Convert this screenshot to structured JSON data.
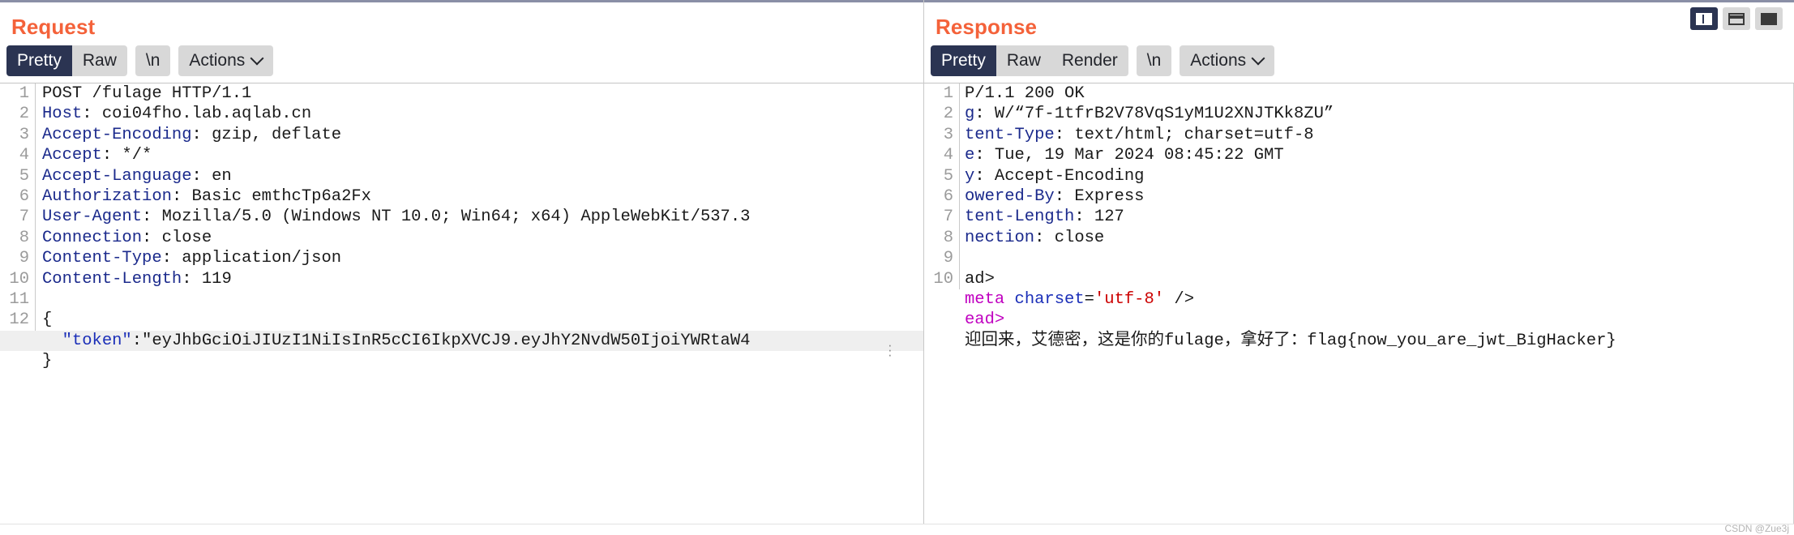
{
  "window": {
    "layout_buttons": [
      {
        "name": "split-vertical",
        "active": true
      },
      {
        "name": "split-horizontal",
        "active": false
      },
      {
        "name": "single-pane",
        "active": false
      }
    ],
    "watermark": "CSDN @Zue3j"
  },
  "request": {
    "title": "Request",
    "toolbar": {
      "pretty": "Pretty",
      "raw": "Raw",
      "newline": "\\n",
      "actions": "Actions"
    },
    "active_tab": "Pretty",
    "lines": [
      {
        "num": "1",
        "text": "POST /fulage HTTP/1.1",
        "header": "",
        "value": "POST /fulage HTTP/1.1"
      },
      {
        "num": "2",
        "text": "Host: coi04fho.lab.aqlab.cn",
        "header": "Host",
        "value": " coi04fho.lab.aqlab.cn"
      },
      {
        "num": "3",
        "text": "Accept-Encoding: gzip, deflate",
        "header": "Accept-Encoding",
        "value": " gzip, deflate"
      },
      {
        "num": "4",
        "text": "Accept: */*",
        "header": "Accept",
        "value": " */*"
      },
      {
        "num": "5",
        "text": "Accept-Language: en",
        "header": "Accept-Language",
        "value": " en"
      },
      {
        "num": "6",
        "text": "Authorization: Basic emthcTp6a2Fx",
        "header": "Authorization",
        "value": " Basic emthcTp6a2Fx"
      },
      {
        "num": "7",
        "text": "User-Agent: Mozilla/5.0 (Windows NT 10.0; Win64; x64) AppleWebKit/537.3",
        "header": "User-Agent",
        "value": " Mozilla/5.0 (Windows NT 10.0; Win64; x64) AppleWebKit/537.3"
      },
      {
        "num": "8",
        "text": "Connection: close",
        "header": "Connection",
        "value": " close"
      },
      {
        "num": "9",
        "text": "Content-Type: application/json",
        "header": "Content-Type",
        "value": " application/json"
      },
      {
        "num": "10",
        "text": "Content-Length: 119",
        "header": "Content-Length",
        "value": " 119"
      },
      {
        "num": "11",
        "text": "",
        "header": "",
        "value": ""
      },
      {
        "num": "12",
        "text": "{",
        "header": "",
        "value": "{"
      }
    ],
    "body": {
      "token_key": "\"token\"",
      "token_colon": ":",
      "token_value": "\"eyJhbGciOiJIUzI1NiIsInR5cCI6IkpXVCJ9.eyJhY2NvdW50IjoiYWRtaW4",
      "closing_brace": "}"
    }
  },
  "response": {
    "title": "Response",
    "toolbar": {
      "pretty": "Pretty",
      "raw": "Raw",
      "render": "Render",
      "newline": "\\n",
      "actions": "Actions"
    },
    "active_tab": "Pretty",
    "lines": [
      {
        "num": "1",
        "text": "P/1.1 200 OK",
        "header": "",
        "value": "P/1.1 200 OK"
      },
      {
        "num": "2",
        "text": "g: W/“7f-1tfrB2V78VqS1yM1U2XNJTKk8ZU”",
        "header": "g",
        "value": " W/“7f-1tfrB2V78VqS1yM1U2XNJTKk8ZU”"
      },
      {
        "num": "3",
        "text": "tent-Type: text/html; charset=utf-8",
        "header": "tent-Type",
        "value": " text/html; charset=utf-8"
      },
      {
        "num": "4",
        "text": "e: Tue, 19 Mar 2024 08:45:22 GMT",
        "header": "e",
        "value": " Tue, 19 Mar 2024 08:45:22 GMT"
      },
      {
        "num": "5",
        "text": "y: Accept-Encoding",
        "header": "y",
        "value": " Accept-Encoding"
      },
      {
        "num": "6",
        "text": "owered-By: Express",
        "header": "owered-By",
        "value": " Express"
      },
      {
        "num": "7",
        "text": "tent-Length: 127",
        "header": "tent-Length",
        "value": " 127"
      },
      {
        "num": "8",
        "text": "nection: close",
        "header": "nection",
        "value": " close"
      },
      {
        "num": "9",
        "text": "",
        "header": "",
        "value": ""
      },
      {
        "num": "10",
        "text": "ad>",
        "header": "",
        "value": "ad>"
      }
    ],
    "html_body": {
      "meta_tag": "meta",
      "meta_attr": "charset",
      "meta_eq": "=",
      "meta_value": "'utf-8'",
      "meta_close": "/>",
      "meta_open": "<",
      "head_close": "ead>",
      "message": "迎回来，艾德密，这是你的fulage，拿好了：flag{now_you_are_jwt_BigHacker}"
    }
  },
  "colors": {
    "title": "#f4623a",
    "active_tab_bg": "#2b3452",
    "button_bg": "#d8d8d8",
    "header_name": "#1b2a8c",
    "json_key": "#1b2fb8",
    "html_tag": "#c000c0",
    "html_attr": "#1b2fb8",
    "html_string": "#cc0000",
    "highlight_row": "#efefef"
  }
}
